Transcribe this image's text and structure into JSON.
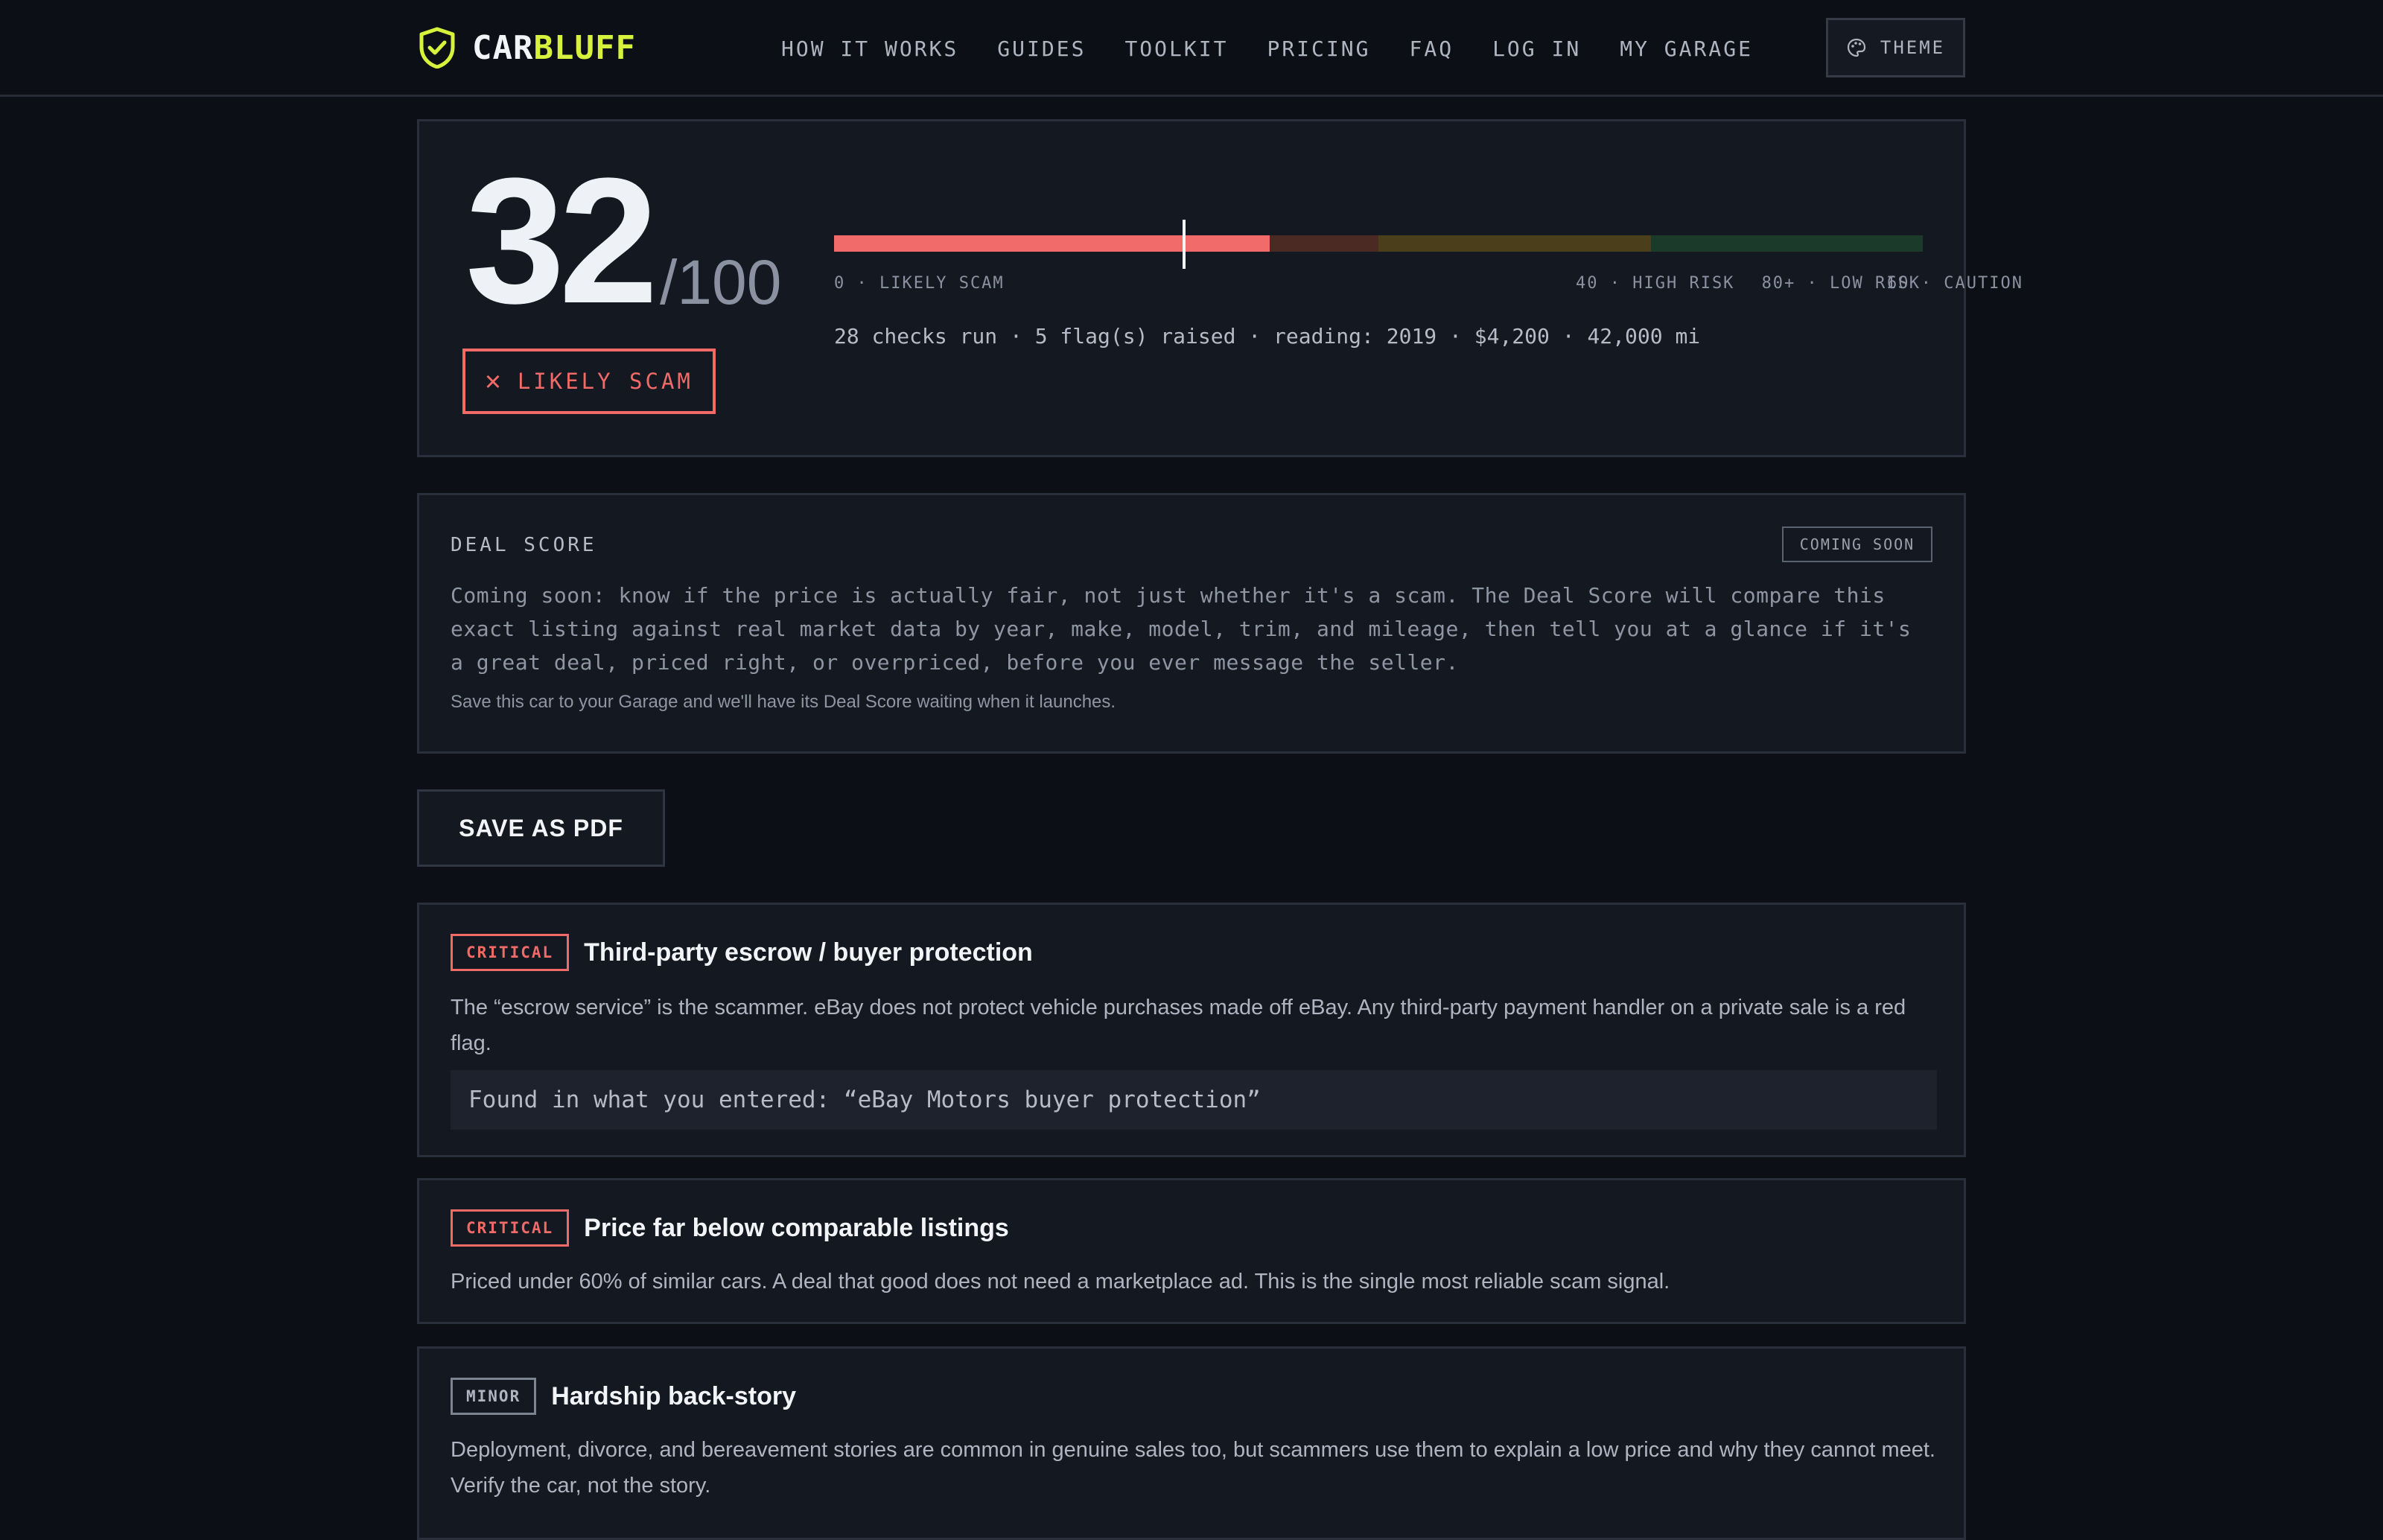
{
  "brand": {
    "part1": "CAR",
    "part2": "BLUFF"
  },
  "nav": [
    "HOW IT WORKS",
    "GUIDES",
    "TOOLKIT",
    "PRICING",
    "FAQ",
    "LOG IN",
    "MY GARAGE"
  ],
  "theme_button": "THEME",
  "score": {
    "value": "32",
    "denominator": "/100",
    "verdict": "LIKELY SCAM",
    "verdict_icon": "close-icon",
    "meter_fraction": 0.4,
    "marker_fraction": 0.32,
    "scale_labels": [
      "0 · LIKELY SCAM",
      "40 · HIGH RISK",
      "60 · CAUTION",
      "80+ · LOW RISK"
    ],
    "stats": "28 checks run · 5 flag(s) raised · reading: 2019 · $4,200 · 42,000 mi"
  },
  "colors": {
    "accent": "#d6f23c",
    "critical": "#f06a68",
    "bar_red": "#f26b6b",
    "seg_high": "#4a2a22",
    "seg_caution": "#4a3f1a",
    "seg_low": "#1c3a2a"
  },
  "deal_score": {
    "title": "DEAL SCORE",
    "badge": "COMING SOON",
    "body": "Coming soon: know if the price is actually fair, not just whether it's a scam. The Deal Score will compare this exact listing against real market data by year, make, model, trim, and mileage, then tell you at a glance if it's a great deal, priced right, or overpriced, before you ever message the seller.",
    "note": "Save this car to your Garage and we'll have its Deal Score waiting when it launches."
  },
  "pdf_button": "SAVE AS PDF",
  "flags": [
    {
      "severity": "CRITICAL",
      "title": "Third-party escrow / buyer protection",
      "desc": "The “escrow service” is the scammer. eBay does not protect vehicle purchases made off eBay. Any third-party payment handler on a private sale is a red flag.",
      "found": "Found in what you entered: “eBay Motors buyer protection”"
    },
    {
      "severity": "CRITICAL",
      "title": "Price far below comparable listings",
      "desc": "Priced under 60% of similar cars. A deal that good does not need a marketplace ad. This is the single most reliable scam signal."
    },
    {
      "severity": "MINOR",
      "title": "Hardship back-story",
      "desc": "Deployment, divorce, and bereavement stories are common in genuine sales too, but scammers use them to explain a low price and why they cannot meet. Verify the car, not the story."
    }
  ]
}
